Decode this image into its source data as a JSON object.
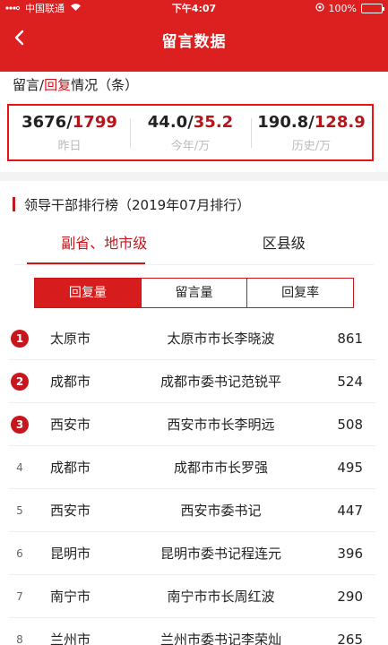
{
  "status_bar": {
    "carrier": "中国联通",
    "time": "下午4:07",
    "battery": "100%",
    "battery_level": 1.0
  },
  "navbar": {
    "title": "留言数据",
    "back_icon": "chevron-left-icon"
  },
  "summary": {
    "heading_prefix": "留言/",
    "heading_highlight": "回复",
    "heading_suffix": "情况（条）",
    "stats": [
      {
        "primary": "3676/",
        "secondary": "1799",
        "label": "昨日"
      },
      {
        "primary": "44.0/",
        "secondary": "35.2",
        "label": "今年/万"
      },
      {
        "primary": "190.8/",
        "secondary": "128.9",
        "label": "历史/万"
      }
    ]
  },
  "ranking": {
    "title": "领导干部排行榜（2019年07月排行）",
    "tabs": [
      "副省、地市级",
      "区县级"
    ],
    "active_tab": 0,
    "segments": [
      "回复量",
      "留言量",
      "回复率"
    ],
    "active_segment": 0,
    "rows": [
      {
        "rank": "1",
        "city": "太原市",
        "person": "太原市市长李晓波",
        "count": "861"
      },
      {
        "rank": "2",
        "city": "成都市",
        "person": "成都市委书记范锐平",
        "count": "524"
      },
      {
        "rank": "3",
        "city": "西安市",
        "person": "西安市市长李明远",
        "count": "508"
      },
      {
        "rank": "4",
        "city": "成都市",
        "person": "成都市市长罗强",
        "count": "495"
      },
      {
        "rank": "5",
        "city": "西安市",
        "person": "西安市委书记",
        "count": "447"
      },
      {
        "rank": "6",
        "city": "昆明市",
        "person": "昆明市委书记程连元",
        "count": "396"
      },
      {
        "rank": "7",
        "city": "南宁市",
        "person": "南宁市市长周红波",
        "count": "290"
      },
      {
        "rank": "8",
        "city": "兰州市",
        "person": "兰州市委书记李荣灿",
        "count": "265"
      }
    ]
  },
  "colors": {
    "brand_red": "#dc1f1f",
    "accent_red": "#c8161d"
  }
}
